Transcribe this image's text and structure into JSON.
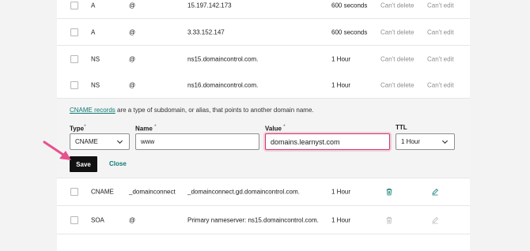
{
  "records": [
    {
      "type": "A",
      "name": "@",
      "value": "15.197.142.173",
      "ttl": "600 seconds",
      "delete": "Can't delete",
      "edit": "Can't edit"
    },
    {
      "type": "A",
      "name": "@",
      "value": "3.33.152.147",
      "ttl": "600 seconds",
      "delete": "Can't delete",
      "edit": "Can't edit"
    },
    {
      "type": "NS",
      "name": "@",
      "value": "ns15.domaincontrol.com.",
      "ttl": "1 Hour",
      "delete": "Can't delete",
      "edit": "Can't edit"
    },
    {
      "type": "NS",
      "name": "@",
      "value": "ns16.domaincontrol.com.",
      "ttl": "1 Hour",
      "delete": "Can't delete",
      "edit": "Can't edit"
    }
  ],
  "editor": {
    "description_link": "CNAME records",
    "description_rest": " are a type of subdomain, or alias, that points to another domain name.",
    "type_label": "Type",
    "name_label": "Name",
    "value_label": "Value",
    "ttl_label": "TTL",
    "required_mark": "*",
    "type_value": "CNAME",
    "name_value": "www",
    "value_value": "domains.learnyst.com",
    "ttl_value": "1 Hour",
    "save_label": "Save",
    "close_label": "Close"
  },
  "records_after": [
    {
      "type": "CNAME",
      "name": "_domainconnect",
      "value": "_domainconnect.gd.domaincontrol.com.",
      "ttl": "1 Hour"
    },
    {
      "type": "SOA",
      "name": "@",
      "value": "Primary nameserver: ns15.domaincontrol.com.",
      "ttl": "1 Hour"
    }
  ],
  "icons": {
    "delete": "trash-icon",
    "edit": "pencil-icon",
    "pointer": "arrow-pointer"
  },
  "colors": {
    "accent_teal": "#0d7a73",
    "focus_pink": "#d6336c",
    "arrow_pink": "#e8508e",
    "button_black": "#111111"
  }
}
